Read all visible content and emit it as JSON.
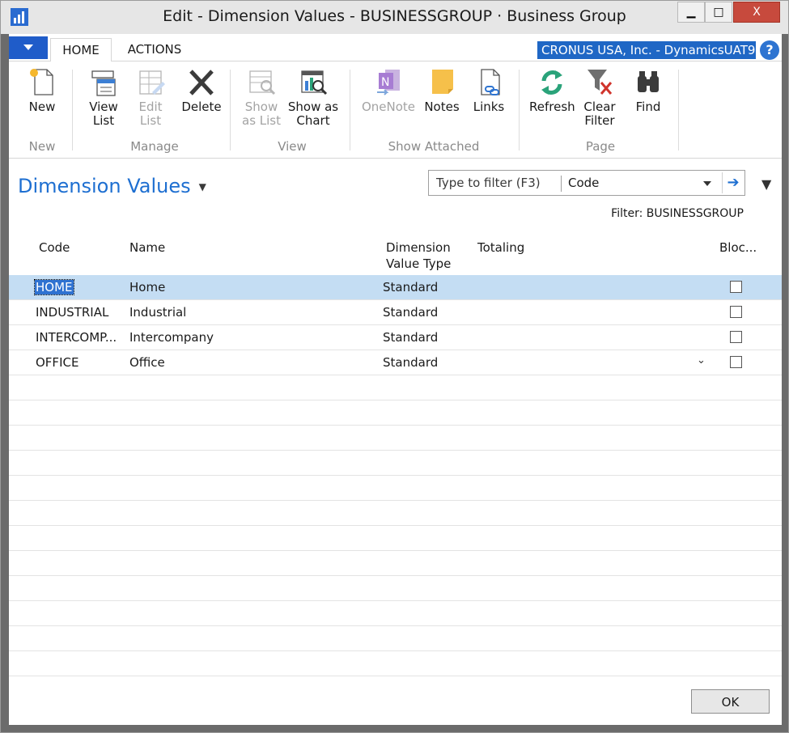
{
  "window": {
    "title": "Edit - Dimension Values - BUSINESSGROUP · Business Group",
    "minimize": "▁",
    "maximize": "□",
    "close": "X"
  },
  "tabs": [
    {
      "label": "HOME",
      "active": true
    },
    {
      "label": "ACTIONS",
      "active": false
    }
  ],
  "company": "CRONUS USA, Inc. - DynamicsUAT9...",
  "help": "?",
  "ribbon": {
    "groups": [
      {
        "label": "New",
        "buttons": [
          {
            "label": "New",
            "icon": "new-document-icon",
            "enabled": true
          }
        ]
      },
      {
        "label": "Manage",
        "buttons": [
          {
            "label": "View\nList",
            "icon": "view-list-icon",
            "enabled": true
          },
          {
            "label": "Edit\nList",
            "icon": "edit-list-icon",
            "enabled": false
          },
          {
            "label": "Delete",
            "icon": "delete-icon",
            "enabled": true
          }
        ]
      },
      {
        "label": "View",
        "buttons": [
          {
            "label": "Show\nas List",
            "icon": "show-as-list-icon",
            "enabled": false
          },
          {
            "label": "Show as\nChart",
            "icon": "show-as-chart-icon",
            "enabled": true
          }
        ]
      },
      {
        "label": "Show Attached",
        "buttons": [
          {
            "label": "OneNote",
            "icon": "onenote-icon",
            "enabled": false
          },
          {
            "label": "Notes",
            "icon": "notes-icon",
            "enabled": true
          },
          {
            "label": "Links",
            "icon": "links-icon",
            "enabled": true
          }
        ]
      },
      {
        "label": "Page",
        "buttons": [
          {
            "label": "Refresh",
            "icon": "refresh-icon",
            "enabled": true
          },
          {
            "label": "Clear\nFilter",
            "icon": "clear-filter-icon",
            "enabled": true
          },
          {
            "label": "Find",
            "icon": "find-icon",
            "enabled": true
          }
        ]
      }
    ]
  },
  "page": {
    "title": "Dimension Values",
    "filter_placeholder": "Type to filter (F3)",
    "filter_field": "Code",
    "filter_text": "Filter: BUSINESSGROUP"
  },
  "columns": {
    "code": "Code",
    "name": "Name",
    "dim_type_line1": "Dimension",
    "dim_type_line2": "Value Type",
    "totaling": "Totaling",
    "blocked": "Bloc..."
  },
  "rows": [
    {
      "code": "HOME",
      "name": "Home",
      "type": "Standard",
      "totaling": "",
      "blocked": false,
      "selected": true
    },
    {
      "code": "INDUSTRIAL",
      "name": "Industrial",
      "type": "Standard",
      "totaling": "",
      "blocked": false,
      "selected": false
    },
    {
      "code": "INTERCOMP...",
      "name": "Intercompany",
      "type": "Standard",
      "totaling": "",
      "blocked": false,
      "selected": false
    },
    {
      "code": "OFFICE",
      "name": "Office",
      "type": "Standard",
      "totaling": "",
      "blocked": false,
      "selected": false
    }
  ],
  "ok_label": "OK",
  "colors": {
    "accent": "#1e6fd1",
    "selection": "#c4ddf3",
    "close_button": "#c74a3d"
  }
}
